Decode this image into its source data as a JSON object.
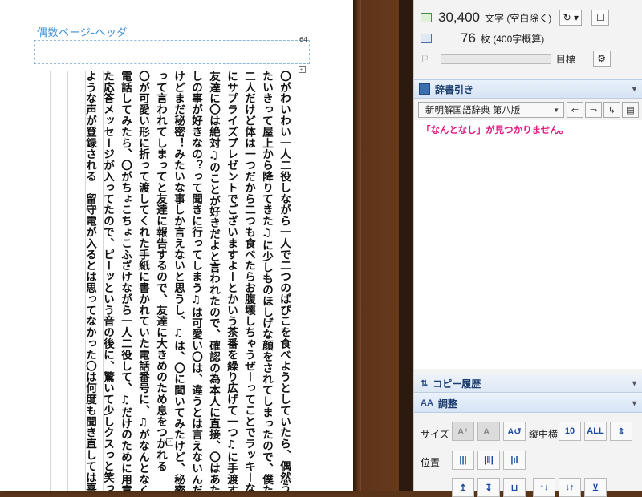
{
  "document": {
    "header_label": "偶数ページ-ヘッダ",
    "page_number": "64",
    "columns": [
      "〇がわいわい一人二役しながら一人で二つのぱぴこを食べようとしていたら、偶然う",
      "たいきって屋上から降りてきた♫に少しものほしげな顔をされてしまったので、僕たち",
      "二人だけど体は一つだから二つも食べたらお腹壊しちゃうぜーってことでラッキーな♫",
      "にサプライズプレゼントでございますよーとかいう茶番を繰り広げて一つ♫に手渡す",
      "友達に〇は絶対♫のことが好きだよと言われたので、確認の為本人に直接、〇はあた",
      "しの事が好きなの？って聞きに行ってしまう♫は可愛い〇は、違うとは言えないんだ",
      "けどまだ秘密！みたいな事しか言えないと思うし、♫は、〇に聞いてみたけど、秘密だ",
      "って言われてしまってと友達に報告するので、友達に大きめのため息をつかれる",
      "〇が可愛い形に折って渡してくれた手紙に書かれていた電話番号に、♫がなんとなく",
      "電話してみたら、〇がちょこちょこふざけながら一人二役して、♫だけのために用意し",
      "た応答メッセージが入ってたので、ピーッという音の後に、驚いて少しクスっと笑ってる",
      "ような声が登録される　留守電が入るとは思ってなかった〇は何度も聞き直しては喜ぶ"
    ]
  },
  "panel": {
    "char_count": "30,400",
    "char_count_label": "文字 (空白除く)",
    "page_count": "76",
    "page_count_label": "枚 (400字概算)",
    "goal_label": "目標",
    "dictionary": {
      "title": "辞書引き",
      "selected_dictionary": "新明解国語辞典 第八版",
      "message": "「なんとなし」が見つかりません。"
    },
    "copy_history": {
      "title": "コピー履歴"
    },
    "adjust": {
      "title": "調整",
      "size_label": "サイズ",
      "orientation_label": "縦中横",
      "position_label": "位置"
    }
  }
}
